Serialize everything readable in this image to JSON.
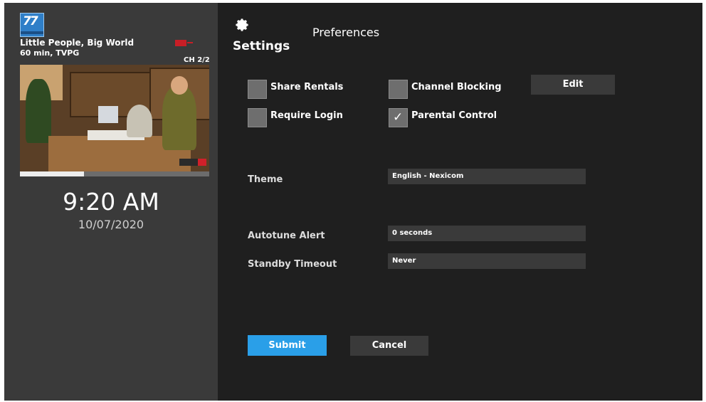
{
  "program": {
    "logo_icon": "network-logo-icon",
    "logo_text": "77",
    "title": "Little People, Big World",
    "info": "60 min, TVPG",
    "channel": "CH 2/2",
    "rating_badge_color": "#c81e26",
    "watch_progress_percent": 34
  },
  "clock": {
    "time": "9:20 AM",
    "date": "10/07/2020"
  },
  "header": {
    "icon": "gear-icon",
    "settings_label": "Settings",
    "page_title": "Preferences"
  },
  "options": {
    "share_rentals": {
      "label": "Share Rentals",
      "checked": false
    },
    "require_login": {
      "label": "Require Login",
      "checked": false
    },
    "channel_blocking": {
      "label": "Channel Blocking",
      "checked": false
    },
    "parental_control": {
      "label": "Parental Control",
      "checked": true
    },
    "checkmark": "✓",
    "edit_label": "Edit"
  },
  "fields": {
    "theme": {
      "label": "Theme",
      "value": "English - Nexicom"
    },
    "autotune_alert": {
      "label": "Autotune Alert",
      "value": "0 seconds"
    },
    "standby_timeout": {
      "label": "Standby Timeout",
      "value": "Never"
    }
  },
  "actions": {
    "submit_label": "Submit",
    "cancel_label": "Cancel",
    "submit_color": "#2a9fe8"
  }
}
